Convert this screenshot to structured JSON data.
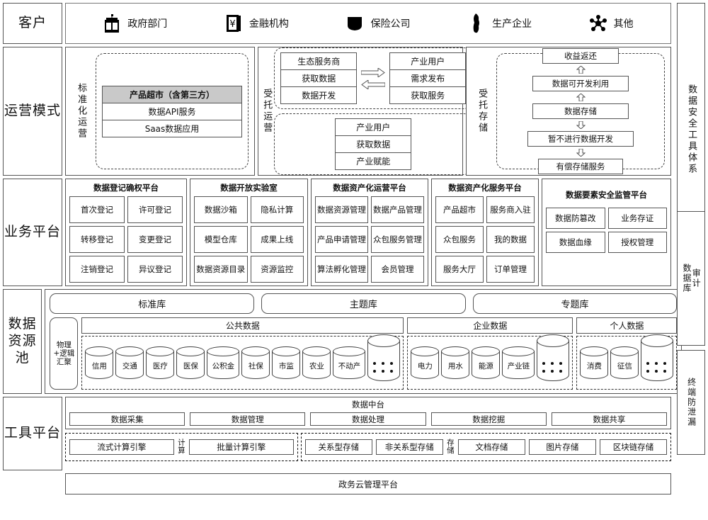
{
  "sidebar": {
    "items": [
      {
        "label": "客户"
      },
      {
        "label": "运营模式"
      },
      {
        "label": "业务平台"
      },
      {
        "label": "数据资源池"
      },
      {
        "label": "工具平台"
      }
    ]
  },
  "right_rail": {
    "security_tools": "数据安全工具体系",
    "db_audit_a": "数据库",
    "db_audit_b": "审计",
    "endpoint_dlp": "终端防泄漏"
  },
  "customers": {
    "items": [
      {
        "label": "政府部门",
        "icon": "government-building-icon"
      },
      {
        "label": "金融机构",
        "icon": "bank-book-icon"
      },
      {
        "label": "保险公司",
        "icon": "shield-block-icon"
      },
      {
        "label": "生产企业",
        "icon": "factory-silhouette-icon"
      },
      {
        "label": "其他",
        "icon": "network-nodes-icon"
      }
    ]
  },
  "operating_modes": {
    "standardized": {
      "label": "标准化运营",
      "stack": [
        "产品超市（含第三方）",
        "数据API服务",
        "Saas数据应用"
      ]
    },
    "entrusted_operation": {
      "label": "受托运营",
      "left_stack": [
        "生态服务商",
        "获取数据",
        "数据开发"
      ],
      "right_stack": [
        "产业用户",
        "需求发布",
        "获取服务"
      ],
      "bottom_stack": [
        "产业用户",
        "获取数据",
        "产业赋能"
      ]
    },
    "entrusted_storage": {
      "label": "受托存储",
      "flow": [
        "收益返还",
        "数据可开发利用",
        "数据存储",
        "暂不进行数据开发",
        "有偿存储服务"
      ]
    }
  },
  "business_platforms": [
    {
      "title": "数据登记确权平台",
      "tiles": [
        "首次登记",
        "许可登记",
        "转移登记",
        "变更登记",
        "注销登记",
        "异议登记"
      ]
    },
    {
      "title": "数据开放实验室",
      "tiles": [
        "数据沙箱",
        "隐私计算",
        "模型仓库",
        "成果上线",
        "数据资源目录",
        "资源监控"
      ]
    },
    {
      "title": "数据资产化运营平台",
      "tiles": [
        "数据资源管理",
        "数据产品管理",
        "产品申请管理",
        "众包服务管理",
        "算法孵化管理",
        "会员管理"
      ]
    },
    {
      "title": "数据资产化服务平台",
      "tiles": [
        "产品超市",
        "服务商入驻",
        "众包服务",
        "我的数据",
        "服务大厅",
        "订单管理"
      ]
    },
    {
      "title": "数据要素安全监管平台",
      "tiles": [
        "数据防篡改",
        "业务存证",
        "数据血缘",
        "授权管理"
      ]
    }
  ],
  "resource_pool": {
    "libraries": [
      "标准库",
      "主题库",
      "专题库"
    ],
    "aggregation_label": "物理+逻辑汇聚",
    "groups": [
      {
        "name": "公共数据",
        "items": [
          "信用",
          "交通",
          "医疗",
          "医保",
          "公积金",
          "社保",
          "市监",
          "农业",
          "不动产"
        ],
        "more": true
      },
      {
        "name": "企业数据",
        "items": [
          "电力",
          "用水",
          "能源",
          "产业链"
        ],
        "more": true
      },
      {
        "name": "个人数据",
        "items": [
          "消费",
          "征信"
        ],
        "more": true
      }
    ]
  },
  "tool_platform": {
    "data_midend": {
      "title": "数据中台",
      "items": [
        "数据采集",
        "数据管理",
        "数据处理",
        "数据挖掘",
        "数据共享"
      ]
    },
    "compute": {
      "label": "计算",
      "items": [
        "流式计算引擎",
        "批量计算引擎"
      ]
    },
    "storage": {
      "label": "存储",
      "items": [
        "关系型存储",
        "非关系型存储",
        "文档存储",
        "图片存储",
        "区块链存储"
      ]
    }
  },
  "bottom": {
    "cloud_platform": "政务云管理平台"
  }
}
